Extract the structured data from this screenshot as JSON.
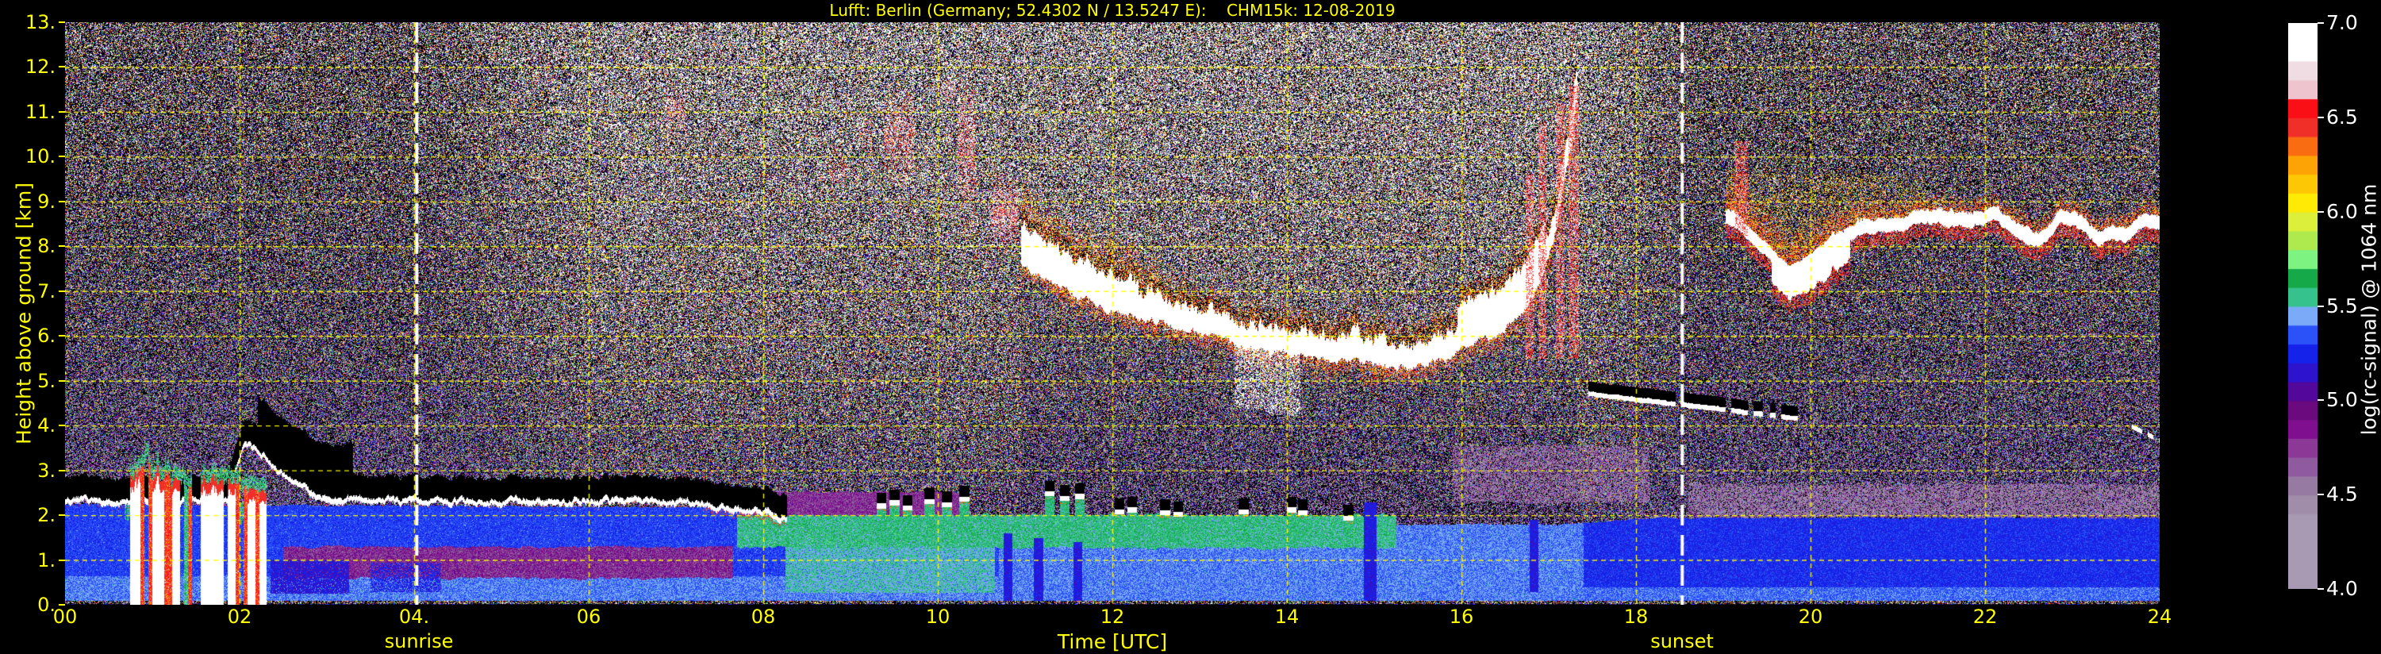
{
  "title": "Lufft: Berlin (Germany; 52.4302 N / 13.5247 E):    CHM15k: 12-08-2019",
  "axes": {
    "ylabel": "Height above ground [km]",
    "xlabel": "Time [UTC]",
    "y_tick_labels": [
      "13.",
      "12.",
      "11.",
      "10.",
      "9.",
      "8.",
      "7.",
      "6.",
      "5.",
      "4.",
      "3.",
      "2.",
      "1.",
      "0."
    ],
    "x_tick_labels": [
      "00",
      "02",
      "04.",
      "06",
      "08",
      "10",
      "12",
      "14",
      "16",
      "18",
      "20",
      "22",
      "24"
    ],
    "sunrise_label": "sunrise",
    "sunset_label": "sunset"
  },
  "colorbar": {
    "label": "log(rc-signal) @ 1064 nm",
    "tick_labels": [
      "7.0",
      "6.5",
      "6.0",
      "5.5",
      "5.0",
      "4.5",
      "4.0"
    ],
    "vmin": 4.0,
    "vmax": 7.0
  },
  "colors": {
    "background": "#000000",
    "axis_text": "#ffff00",
    "colorbar_text": "#ffffff",
    "grid": "#ffff00",
    "sun_line": "#ffffff",
    "under_range": "#000000"
  },
  "chart_data": {
    "type": "heatmap",
    "title": "Lufft: Berlin (Germany; 52.4302 N / 13.5247 E):    CHM15k: 12-08-2019",
    "xlabel": "Time [UTC]",
    "ylabel": "Height above ground [km]",
    "x_range_hours": [
      0,
      24
    ],
    "y_range_km": [
      0,
      13
    ],
    "value_range": [
      4.0,
      7.0
    ],
    "x_tick_step_hours": 2,
    "y_tick_step_km": 1,
    "grid": {
      "on": true,
      "dashed": true
    },
    "sunrise_utc": 4.03,
    "sunset_utc": 18.53,
    "colormap": [
      "#a89ab3",
      "#a89ab3",
      "#a89ab3",
      "#a89ab3",
      "#a08daa",
      "#967aa2",
      "#8f5a9e",
      "#8c3897",
      "#7f0f8e",
      "#6a0a7e",
      "#52089b",
      "#2e13cd",
      "#1523ea",
      "#2a52f8",
      "#7aaaf8",
      "#35c28c",
      "#16a94a",
      "#7df381",
      "#aeea4e",
      "#dcef3a",
      "#fdea05",
      "#fdc705",
      "#fda305",
      "#fa6c12",
      "#f02f28",
      "#fa0f16",
      "#eec5cf",
      "#f0dce3",
      "#ffffff",
      "#ffffff"
    ],
    "features": {
      "noise": {
        "night_base": [
          4.3,
          -0.005
        ],
        "night_amp": [
          0.35,
          0.145
        ],
        "day_base": [
          4.2,
          0.1
        ],
        "day_amp": [
          0.5,
          0.22
        ],
        "day_ramp_up": [
          4.1,
          6.2
        ],
        "day_ramp_down": [
          17.3,
          18.7
        ],
        "under_deck_dim": [
          0.25,
          0.78
        ]
      },
      "boundary_layer": {
        "blue_top": [
          [
            0,
            2.25
          ],
          [
            7.5,
            2.18
          ],
          [
            8.3,
            1.95
          ],
          [
            10.7,
            1.95
          ],
          [
            12,
            1.8
          ],
          [
            17.2,
            1.8
          ],
          [
            18.2,
            1.95
          ],
          [
            24.01,
            1.95
          ]
        ],
        "cap": {
          "t_end": 8.27,
          "value": 6.85,
          "center": [
            [
              0,
              2.34
            ],
            [
              0.8,
              2.3
            ],
            [
              1.85,
              2.42
            ],
            [
              2.05,
              3.62
            ],
            [
              2.3,
              3.3
            ],
            [
              2.6,
              2.7
            ],
            [
              2.9,
              2.42
            ],
            [
              3.4,
              2.3
            ],
            [
              5.0,
              2.3
            ],
            [
              6.5,
              2.33
            ],
            [
              7.2,
              2.28
            ],
            [
              7.6,
              2.18
            ],
            [
              8.0,
              2.06
            ],
            [
              8.27,
              2.0
            ]
          ]
        },
        "values": {
          "morning_blue": 5.31,
          "morning_light": 5.4,
          "light_depth": 0.65,
          "afternoon": [
            10.7,
            17.4,
            5.4
          ],
          "evening": 5.27,
          "evening_light": 5.38,
          "evening_light_depth": 0.4
        }
      },
      "purple_bands": [
        {
          "t0": 2.5,
          "t1": 7.65,
          "h0": 0.6,
          "h1": 1.3,
          "v": 4.8,
          "p": 1.0
        },
        {
          "t0": 7.75,
          "t1": 10.35,
          "h0": 1.75,
          "h1": 2.52,
          "v": 4.78,
          "p": 1.0
        },
        {
          "t0": 15.9,
          "t1": 18.15,
          "h0": 2.3,
          "h1": 3.55,
          "v": 4.58,
          "p": 0.55
        },
        {
          "t0": 18.6,
          "t1": 24.01,
          "h0": 1.95,
          "h1": 2.7,
          "v": 4.55,
          "p": 0.6
        }
      ],
      "dark_blue_patches": [
        {
          "t0": 2.35,
          "t1": 3.25,
          "h0": 0.25,
          "h1": 1.0,
          "v": 5.18,
          "p": 0.85
        },
        {
          "t0": 3.5,
          "t1": 4.3,
          "h0": 0.3,
          "h1": 0.95,
          "v": 5.22,
          "p": 0.6
        }
      ],
      "teal_region": {
        "t0": 8.25,
        "t1": 10.65,
        "h0": 0.28,
        "h1": 1.55,
        "v": 5.5
      },
      "green_band": {
        "t0": 7.7,
        "t1": 15.25,
        "h0": 1.28,
        "h1": 1.98,
        "v": 5.57
      },
      "green_wisps": [
        {
          "t0": 0.18,
          "t1": 0.74
        },
        {
          "t0": 2.0,
          "t1": 2.35
        }
      ],
      "rain": {
        "segments": [
          [
            0.74,
            1.2,
            1.0
          ],
          [
            1.2,
            1.45,
            0.6
          ],
          [
            1.55,
            2.0,
            0.85
          ],
          [
            2.0,
            2.3,
            0.5
          ]
        ],
        "top_base": 2.25,
        "top_extra": 1.9,
        "white_v": 6.88,
        "red_v": 6.45,
        "green_v": 5.6
      },
      "cumulus": [
        [
          9.35,
          2.25
        ],
        [
          9.5,
          2.32
        ],
        [
          9.65,
          2.2
        ],
        [
          9.9,
          2.35
        ],
        [
          10.1,
          2.28
        ],
        [
          10.3,
          2.4
        ],
        [
          11.28,
          2.52
        ],
        [
          11.45,
          2.42
        ],
        [
          11.62,
          2.46
        ],
        [
          12.08,
          2.12
        ],
        [
          12.22,
          2.16
        ],
        [
          12.6,
          2.1
        ],
        [
          12.75,
          2.06
        ],
        [
          13.5,
          2.12
        ],
        [
          14.05,
          2.16
        ],
        [
          14.18,
          2.1
        ],
        [
          14.7,
          1.98
        ]
      ],
      "cloud_deck": {
        "t0": 10.95,
        "t1": 17.32,
        "core_v": 6.95,
        "base": [
          [
            10.95,
            7.6
          ],
          [
            11.2,
            7.35
          ],
          [
            11.5,
            6.95
          ],
          [
            11.8,
            6.75
          ],
          [
            12.1,
            6.55
          ],
          [
            12.4,
            6.4
          ],
          [
            12.7,
            6.2
          ],
          [
            13.0,
            6.05
          ],
          [
            13.3,
            5.9
          ],
          [
            13.6,
            5.75
          ],
          [
            13.9,
            5.65
          ],
          [
            14.2,
            5.55
          ],
          [
            14.5,
            5.45
          ],
          [
            14.8,
            5.4
          ],
          [
            15.1,
            5.35
          ],
          [
            15.4,
            5.35
          ],
          [
            15.7,
            5.45
          ],
          [
            16.0,
            5.65
          ],
          [
            16.2,
            5.85
          ],
          [
            16.45,
            6.1
          ],
          [
            16.7,
            6.55
          ],
          [
            16.9,
            7.2
          ],
          [
            17.05,
            8.2
          ],
          [
            17.2,
            9.6
          ],
          [
            17.32,
            11.2
          ]
        ],
        "patchy": [
          14.2,
          15.9
        ],
        "white_fall": [
          13.4,
          14.15,
          1.35
        ]
      },
      "risers": [
        [
          16.73,
          16.82,
          9.6
        ],
        [
          16.88,
          16.97,
          10.8
        ],
        [
          17.08,
          17.18,
          11.2
        ],
        [
          17.22,
          17.34,
          11.6
        ]
      ],
      "high_wisps": [
        [
          6.88,
          7.12,
          10.3,
          11.7,
          0.3
        ],
        [
          8.75,
          8.95,
          9.0,
          10.5,
          0.2
        ],
        [
          9.1,
          9.25,
          9.8,
          11.2,
          0.25
        ],
        [
          9.38,
          9.72,
          9.3,
          11.6,
          0.4
        ],
        [
          10.0,
          10.2,
          11.2,
          11.75,
          0.25
        ],
        [
          10.22,
          10.42,
          8.2,
          12.1,
          0.4
        ],
        [
          10.6,
          10.92,
          7.8,
          9.7,
          0.5
        ],
        [
          5.35,
          5.6,
          11.3,
          12.25,
          0.15
        ],
        [
          12.35,
          12.52,
          11.3,
          12.0,
          0.15
        ]
      ],
      "streak_4p5km": {
        "t0": 17.45,
        "t1": 20.05,
        "h_start": 4.72,
        "h_end": 4.12,
        "fade_t": 18.9
      },
      "evening_band": {
        "t0": 19.02,
        "t1": 24.01,
        "core_v": 6.92,
        "base": [
          [
            19.02,
            8.6
          ],
          [
            19.2,
            8.35
          ],
          [
            19.45,
            7.9
          ],
          [
            19.6,
            7.55
          ],
          [
            19.75,
            7.3
          ],
          [
            19.9,
            7.45
          ],
          [
            20.1,
            7.8
          ],
          [
            20.35,
            8.1
          ],
          [
            20.6,
            8.25
          ],
          [
            21.0,
            8.45
          ],
          [
            21.4,
            8.55
          ],
          [
            21.8,
            8.5
          ],
          [
            22.1,
            8.6
          ],
          [
            22.4,
            8.2
          ],
          [
            22.55,
            8.0
          ],
          [
            22.7,
            8.15
          ],
          [
            22.85,
            8.5
          ],
          [
            23.0,
            8.55
          ],
          [
            23.15,
            8.3
          ],
          [
            23.3,
            8.05
          ],
          [
            23.45,
            8.2
          ],
          [
            23.6,
            8.1
          ],
          [
            23.75,
            8.45
          ],
          [
            23.9,
            8.4
          ],
          [
            24.01,
            8.45
          ]
        ],
        "deep_white": [
          19.55,
          20.45
        ],
        "red_haze_until": 21.3,
        "red_streak": [
          19.13,
          19.28,
          10.35
        ]
      },
      "low_dashes": {
        "t0": 23.68,
        "t1": 24.01,
        "h_hi": 3.98,
        "h_lo": 3.66
      },
      "rain_shafts": [
        [
          14.88,
          15.02,
          0.1,
          2.3
        ],
        [
          16.78,
          16.88,
          0.3,
          1.9
        ],
        [
          10.75,
          10.85,
          0.0,
          1.6
        ],
        [
          11.1,
          11.2,
          0.0,
          1.5
        ],
        [
          11.55,
          11.65,
          0.0,
          1.4
        ]
      ],
      "bottom_strip_km": 0.105
    }
  }
}
